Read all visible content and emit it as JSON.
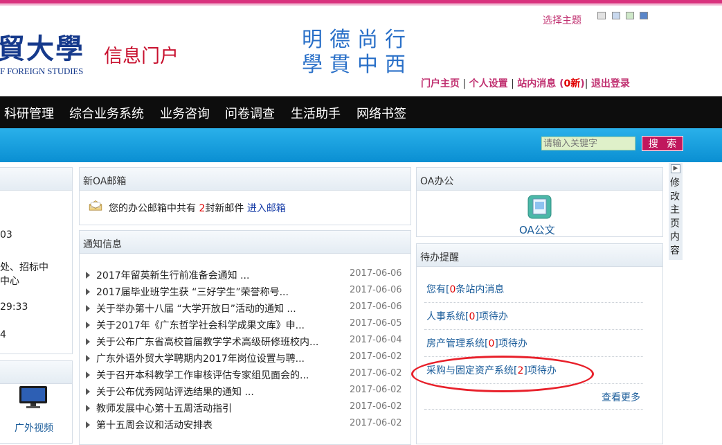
{
  "header": {
    "theme_label": "选择主题",
    "theme_colors": [
      "#e2e2e2",
      "#c9d9ef",
      "#cfe8c9",
      "#5b86c9"
    ],
    "logo_text": "貿大學",
    "logo_subtitle": "F FOREIGN STUDIES",
    "portal_title": "信息门户",
    "motto": "明德尚行學貫中西",
    "links": {
      "home": "门户主页",
      "settings": "个人设置",
      "messages_prefix": "站内消息 (",
      "messages_count": "0新",
      "messages_suffix": ")",
      "logout": "退出登录"
    }
  },
  "nav": {
    "items": [
      "科研管理",
      "综合业务系统",
      "业务咨询",
      "问卷调查",
      "生活助手",
      "网络书签"
    ]
  },
  "search": {
    "placeholder": "请输入关键字",
    "button": "搜 索"
  },
  "left_panel": {
    "lines": [
      "03",
      "处、招标中",
      "中心",
      "29:33",
      "4"
    ],
    "video_label": "广外视频"
  },
  "mail_panel": {
    "title": "新OA邮箱",
    "text_prefix": "您的办公邮箱中共有 ",
    "count": "2",
    "text_suffix": "封新邮件 ",
    "link": "进入邮箱"
  },
  "notice_panel": {
    "title": "通知信息",
    "items": [
      {
        "title": "2017年留英新生行前准备会通知 ...",
        "date": "2017-06-06"
      },
      {
        "title": "2017届毕业班学生获 “三好学生”荣誉称号...",
        "date": "2017-06-06"
      },
      {
        "title": "关于举办第十八届 “大学开放日”活动的通知 ...",
        "date": "2017-06-06"
      },
      {
        "title": "关于2017年《广东哲学社会科学成果文库》申...",
        "date": "2017-06-05"
      },
      {
        "title": "关于公布广东省高校首届教学学术高级研修班校内...",
        "date": "2017-06-04"
      },
      {
        "title": "广东外语外贸大学聘期内2017年岗位设置与聘...",
        "date": "2017-06-02"
      },
      {
        "title": "关于召开本科教学工作审核评估专家组见面会的...",
        "date": "2017-06-02"
      },
      {
        "title": "关于公布优秀网站评选结果的通知 ...",
        "date": "2017-06-02"
      },
      {
        "title": "教师发展中心第十五周活动指引",
        "date": "2017-06-02"
      },
      {
        "title": "第十五周会议和活动安排表",
        "date": "2017-06-02"
      }
    ]
  },
  "oa_panel": {
    "title": "OA办公",
    "link": "OA公文"
  },
  "todo_panel": {
    "title": "待办提醒",
    "items": [
      {
        "prefix": "您有[",
        "count": "0",
        "suffix": "条站内消息"
      },
      {
        "prefix": "人事系统[",
        "count": "0",
        "suffix": "]项待办"
      },
      {
        "prefix": "房产管理系统[",
        "count": "0",
        "suffix": "]项待办"
      },
      {
        "prefix": "采购与固定资产系统[",
        "count": "2",
        "suffix": "]项待办"
      }
    ],
    "more": "查看更多"
  },
  "edit_tab": {
    "label": "修改主页内容"
  },
  "colors": {
    "accent_pink": "#c0175d",
    "nav_bg": "#0d0d0d",
    "search_bar": "#1aa0e0",
    "link_blue": "#1a5c9a",
    "highlight_red": "#e8202a"
  }
}
